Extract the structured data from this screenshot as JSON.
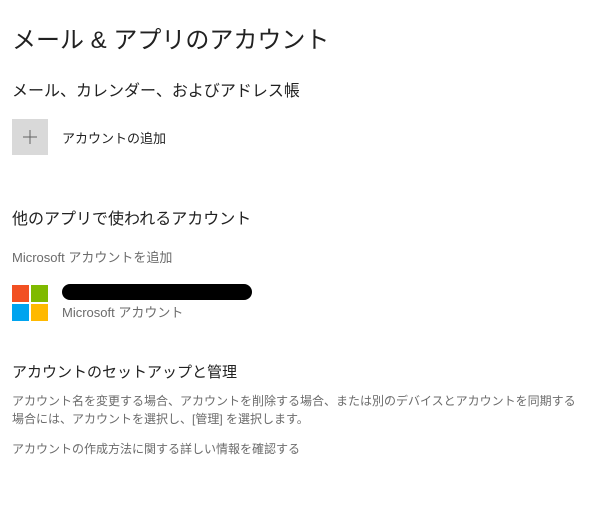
{
  "page": {
    "title": "メール & アプリのアカウント"
  },
  "mailSection": {
    "heading": "メール、カレンダー、およびアドレス帳",
    "addAccountLabel": "アカウントの追加"
  },
  "otherAppsSection": {
    "heading": "他のアプリで使われるアカウント",
    "addMsAccountText": "Microsoft アカウントを追加",
    "account": {
      "type": "Microsoft アカウント"
    }
  },
  "setupSection": {
    "heading": "アカウントのセットアップと管理",
    "description": "アカウント名を変更する場合、アカウントを削除する場合、または別のデバイスとアカウントを同期する場合には、アカウントを選択し、[管理] を選択します。",
    "linkText": "アカウントの作成方法に関する詳しい情報を確認する"
  }
}
